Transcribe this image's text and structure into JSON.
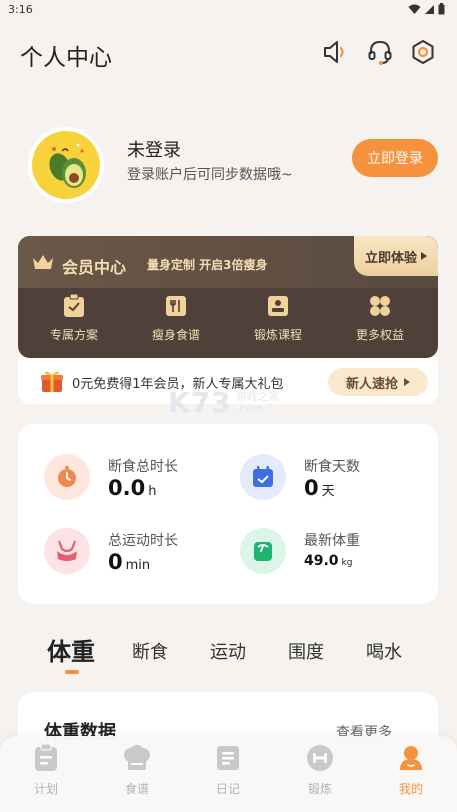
{
  "status_bar": {
    "time": "3:16"
  },
  "header": {
    "title": "个人中心"
  },
  "profile": {
    "name": "未登录",
    "subtitle": "登录账户后可同步数据哦~",
    "login_button": "立即登录"
  },
  "vip": {
    "title": "会员中心",
    "subtitle": "量身定制 开启3倍瘦身",
    "trial_button": "立即体验",
    "items": [
      {
        "label": "专属方案",
        "icon": "clipboard-icon"
      },
      {
        "label": "瘦身食谱",
        "icon": "recipe-book-icon"
      },
      {
        "label": "锻炼课程",
        "icon": "course-icon"
      },
      {
        "label": "更多权益",
        "icon": "clover-icon"
      }
    ]
  },
  "promo": {
    "text": "0元免费得1年会员，新人专属大礼包",
    "button": "新人速抢"
  },
  "watermark": {
    "brand": "K73",
    "line1": "游戏之家",
    "line2": ".com"
  },
  "stats": [
    {
      "label": "断食总时长",
      "value": "0.0",
      "unit": "h",
      "icon": "timer-icon"
    },
    {
      "label": "断食天数",
      "value": "0",
      "unit": "天",
      "icon": "calendar-check-icon"
    },
    {
      "label": "总运动时长",
      "value": "0",
      "unit": "min",
      "icon": "sports-bra-icon"
    },
    {
      "label": "最新体重",
      "value": "49.0",
      "unit": "kg",
      "icon": "scale-icon"
    }
  ],
  "tabs": [
    "体重",
    "断食",
    "运动",
    "围度",
    "喝水"
  ],
  "data_card": {
    "title": "体重数据",
    "more": "查看更多"
  },
  "bottom_nav": [
    {
      "label": "计划",
      "icon": "plan-icon"
    },
    {
      "label": "食谱",
      "icon": "chef-hat-icon"
    },
    {
      "label": "日记",
      "icon": "diary-icon"
    },
    {
      "label": "锻炼",
      "icon": "dumbbell-icon"
    },
    {
      "label": "我的",
      "icon": "profile-icon",
      "active": true
    }
  ],
  "colors": {
    "accent": "#f6913e",
    "vip_bg": "#4f4139",
    "vip_text": "#f4ddb6",
    "background": "#f5f2ef"
  }
}
